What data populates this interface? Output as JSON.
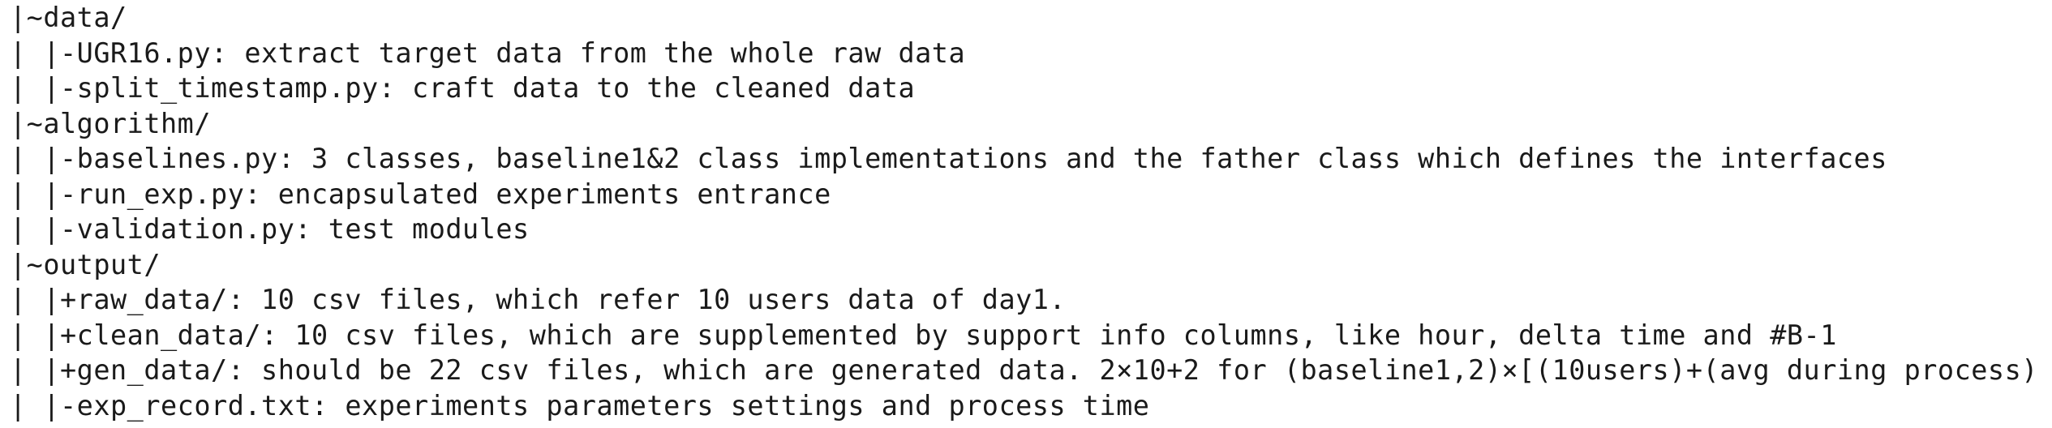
{
  "lines": [
    "|~data/",
    "| |-UGR16.py: extract target data from the whole raw data",
    "| |-split_timestamp.py: craft data to the cleaned data",
    "|~algorithm/",
    "| |-baselines.py: 3 classes, baseline1&2 class implementations and the father class which defines the interfaces",
    "| |-run_exp.py: encapsulated experiments entrance",
    "| |-validation.py: test modules",
    "|~output/",
    "| |+raw_data/: 10 csv files, which refer 10 users data of day1.",
    "| |+clean_data/: 10 csv files, which are supplemented by support info columns, like hour, delta time and #B-1",
    "| |+gen_data/: should be 22 csv files, which are generated data. 2×10+2 for (baseline1,2)×[(10users)+(avg during process)",
    "| |-exp_record.txt: experiments parameters settings and process time"
  ]
}
